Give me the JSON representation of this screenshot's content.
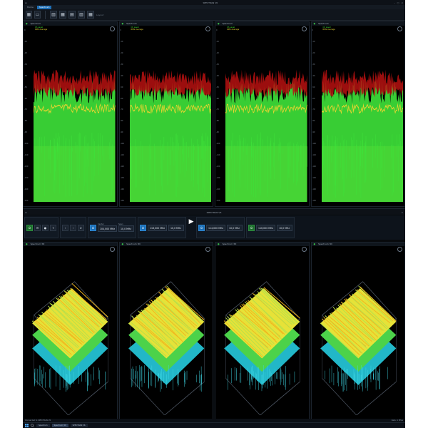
{
  "top_window": {
    "title": "SPECTRAN V6",
    "menu_tabs": [
      "Home",
      "Spectrum"
    ],
    "ribbon_label": "Layout",
    "panels": [
      {
        "tab": "Spectrum",
        "legend": [
          "Ch Level",
          "RMS Average"
        ]
      },
      {
        "tab": "Spectrum",
        "legend": [
          "Ch Level",
          "RMS Average"
        ]
      },
      {
        "tab": "Spectrum",
        "legend": [
          "Ch Level",
          "RMS Average"
        ]
      },
      {
        "tab": "Spectrum",
        "legend": [
          "Ch Level",
          "RMS Average"
        ]
      }
    ],
    "y_ticks": [
      "0",
      "-10",
      "-20",
      "-30",
      "-40",
      "-50",
      "-60",
      "-70",
      "-80",
      "-90",
      "-100",
      "-110",
      "-120",
      "-130",
      "-140",
      "-150"
    ]
  },
  "taskbar_top": {
    "apps": [
      "Spectrum",
      "Spectrum 3D",
      "SPECTRAN V6"
    ],
    "clock": ""
  },
  "bottom_window": {
    "controls": {
      "center_freq_1": "104,000 MHz",
      "span_1": "10,0 MHz",
      "center_freq_2": "116,000 MHz",
      "span_2": "10,0 MHz",
      "center_freq_3": "114,000 MHz",
      "span_3": "10,0 MHz",
      "center_freq_4": "116,000 MHz",
      "span_4": "10,0 MHz",
      "labels": [
        "Center",
        "Span",
        "RBW",
        "Ref Level"
      ]
    },
    "panels": [
      {
        "tab": "Spectrum 3D"
      },
      {
        "tab": "Spectrum 3D"
      },
      {
        "tab": "Spectrum 3D"
      },
      {
        "tab": "Spectrum 3D"
      }
    ],
    "status_left": "Connected to SPECTRAN V6",
    "status_right": "Rate: 1 MS/s"
  },
  "colors": {
    "trace_green": "#3ee33a",
    "trace_red": "#b71111",
    "noise_floor": "#8a4a12",
    "accent": "#1f6fb5",
    "legend_green": "#3ee33a",
    "legend_yellow": "#e8d431"
  }
}
